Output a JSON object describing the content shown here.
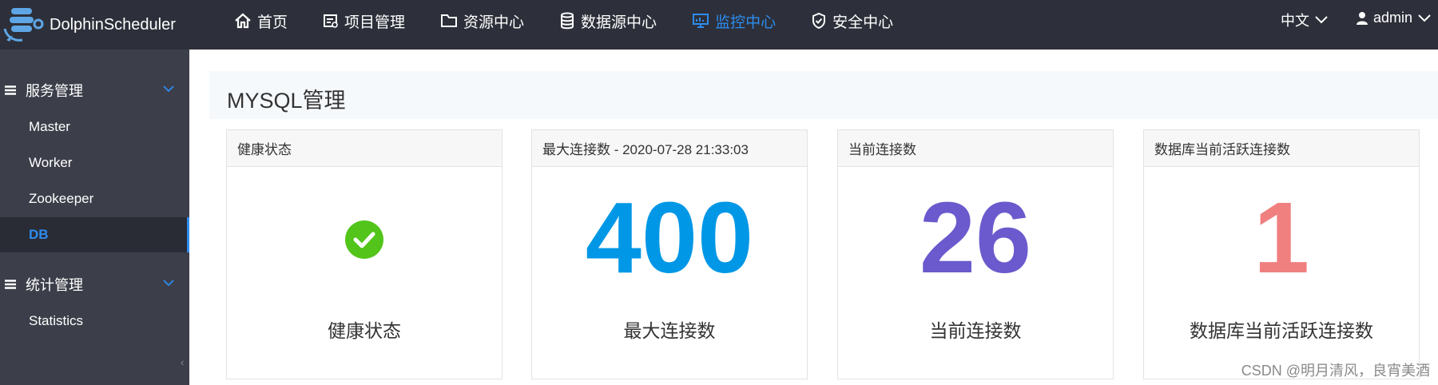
{
  "app": {
    "name": "DolphinScheduler"
  },
  "nav": [
    {
      "label": "首页",
      "icon": "home-icon",
      "active": false
    },
    {
      "label": "项目管理",
      "icon": "project-icon",
      "active": false
    },
    {
      "label": "资源中心",
      "icon": "folder-icon",
      "active": false
    },
    {
      "label": "数据源中心",
      "icon": "database-icon",
      "active": false
    },
    {
      "label": "监控中心",
      "icon": "monitor-icon",
      "active": true
    },
    {
      "label": "安全中心",
      "icon": "shield-icon",
      "active": false
    }
  ],
  "lang": {
    "label": "中文"
  },
  "user": {
    "name": "admin"
  },
  "sidebar": {
    "groups": [
      {
        "label": "服务管理",
        "items": [
          "Master",
          "Worker",
          "Zookeeper",
          "DB"
        ]
      },
      {
        "label": "统计管理",
        "items": [
          "Statistics"
        ]
      }
    ],
    "active_item": "DB",
    "collapse_glyph": "‹"
  },
  "page": {
    "title": "MYSQL管理"
  },
  "cards": [
    {
      "header": "健康状态",
      "label": "健康状态",
      "type": "status",
      "status": "healthy",
      "color": "#52c41a"
    },
    {
      "header": "最大连接数 - 2020-07-28 21:33:03",
      "label": "最大连接数",
      "type": "number",
      "value": "400",
      "color": "#0097e6"
    },
    {
      "header": "当前连接数",
      "label": "当前连接数",
      "type": "number",
      "value": "26",
      "color": "#6a5acd"
    },
    {
      "header": "数据库当前活跃连接数",
      "label": "数据库当前活跃连接数",
      "type": "number",
      "value": "1",
      "color": "#f08080"
    }
  ],
  "watermark": "CSDN @明月清风，良宵美酒",
  "colors": {
    "topbar": "#2d303a",
    "sidebar": "#3c3f4a",
    "accent": "#2d8cf0"
  }
}
